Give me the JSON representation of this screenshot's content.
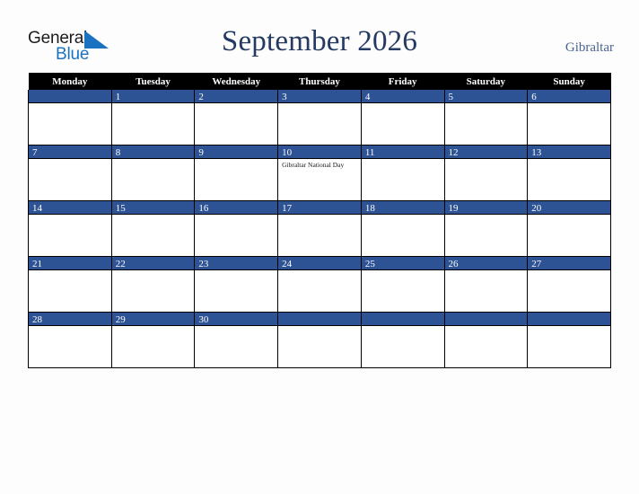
{
  "brand": {
    "name_part1": "General",
    "name_part2": "Blue",
    "flag_icon": "triangle-flag-icon",
    "color_text": "#1c1c1c",
    "color_blue": "#1b72c0"
  },
  "header": {
    "title": "September 2026",
    "country": "Gibraltar",
    "title_color": "#253a62",
    "country_color": "#4a6490"
  },
  "calendar": {
    "weekday_headers": [
      "Monday",
      "Tuesday",
      "Wednesday",
      "Thursday",
      "Friday",
      "Saturday",
      "Sunday"
    ],
    "header_background": "#000000",
    "header_text_color": "#ffffff",
    "daybar_background": "#2e5394",
    "daybar_text_color": "#ffffff",
    "cell_background": "#ffffff",
    "grid_line_color": "#000000",
    "weeks": [
      [
        {
          "day": "",
          "events": []
        },
        {
          "day": "1",
          "events": []
        },
        {
          "day": "2",
          "events": []
        },
        {
          "day": "3",
          "events": []
        },
        {
          "day": "4",
          "events": []
        },
        {
          "day": "5",
          "events": []
        },
        {
          "day": "6",
          "events": []
        }
      ],
      [
        {
          "day": "7",
          "events": []
        },
        {
          "day": "8",
          "events": []
        },
        {
          "day": "9",
          "events": []
        },
        {
          "day": "10",
          "events": [
            "Gibraltar National Day"
          ]
        },
        {
          "day": "11",
          "events": []
        },
        {
          "day": "12",
          "events": []
        },
        {
          "day": "13",
          "events": []
        }
      ],
      [
        {
          "day": "14",
          "events": []
        },
        {
          "day": "15",
          "events": []
        },
        {
          "day": "16",
          "events": []
        },
        {
          "day": "17",
          "events": []
        },
        {
          "day": "18",
          "events": []
        },
        {
          "day": "19",
          "events": []
        },
        {
          "day": "20",
          "events": []
        }
      ],
      [
        {
          "day": "21",
          "events": []
        },
        {
          "day": "22",
          "events": []
        },
        {
          "day": "23",
          "events": []
        },
        {
          "day": "24",
          "events": []
        },
        {
          "day": "25",
          "events": []
        },
        {
          "day": "26",
          "events": []
        },
        {
          "day": "27",
          "events": []
        }
      ],
      [
        {
          "day": "28",
          "events": []
        },
        {
          "day": "29",
          "events": []
        },
        {
          "day": "30",
          "events": []
        },
        {
          "day": "",
          "events": []
        },
        {
          "day": "",
          "events": []
        },
        {
          "day": "",
          "events": []
        },
        {
          "day": "",
          "events": []
        }
      ]
    ]
  }
}
